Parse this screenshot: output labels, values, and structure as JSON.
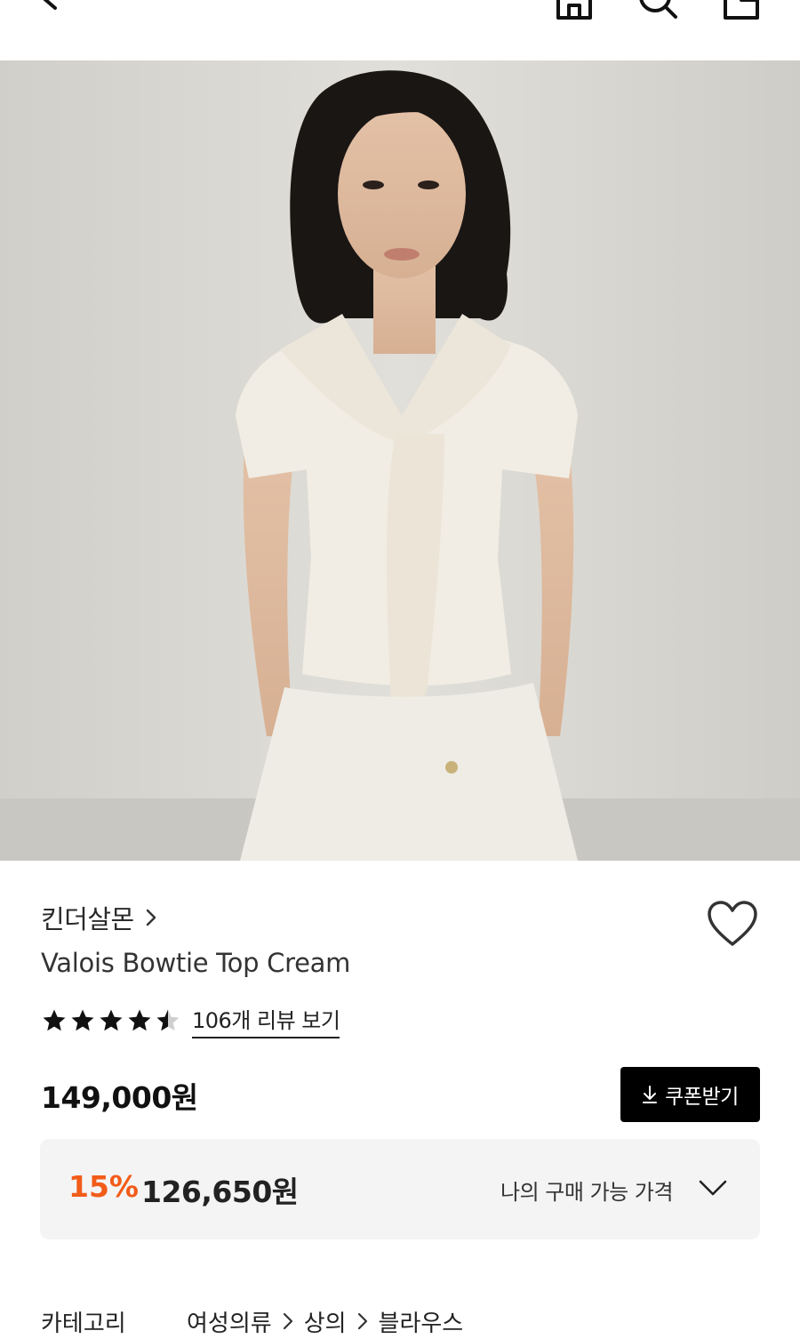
{
  "header": {
    "back_icon": "arrow-left-icon",
    "home_icon": "home-icon",
    "search_icon": "search-icon",
    "cart_icon": "bag-icon"
  },
  "product": {
    "image_description": "model-in-cream-bowtie-top",
    "brand": "킨더살몬",
    "name": "Valois Bowtie Top Cream",
    "rating": 4.5,
    "review_link": "106개 리뷰 보기",
    "price": "149,000원",
    "coupon_button": "쿠폰받기",
    "discount": {
      "rate": "15%",
      "price": "126,650원",
      "my_price_label": "나의 구매 가능 가격"
    },
    "category": {
      "label": "카테고리",
      "path": [
        "여성의류",
        "상의",
        "블라우스"
      ]
    }
  },
  "colors": {
    "accent_discount": "#f25c19",
    "button_bg": "#000000",
    "discount_box_bg": "#f4f4f4"
  }
}
